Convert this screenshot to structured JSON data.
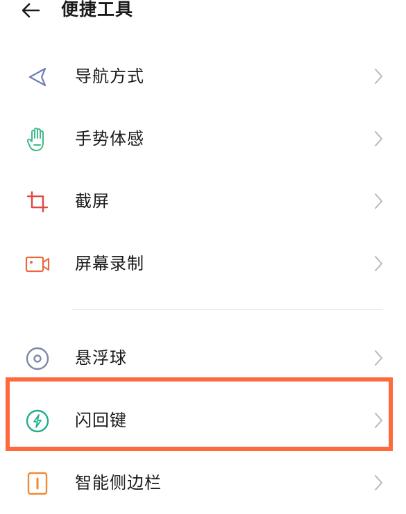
{
  "header": {
    "title": "便捷工具",
    "back_icon": "arrow-left-icon"
  },
  "items": [
    {
      "label": "导航方式",
      "icon": "navigation-arrow-icon",
      "icon_color": "#6c7fb3"
    },
    {
      "label": "手势体感",
      "icon": "hand-gesture-icon",
      "icon_color": "#3dbb86"
    },
    {
      "label": "截屏",
      "icon": "crop-icon",
      "icon_color": "#e0463e"
    },
    {
      "label": "屏幕录制",
      "icon": "video-camera-icon",
      "icon_color": "#e86a3a"
    },
    {
      "label": "悬浮球",
      "icon": "floating-ball-icon",
      "icon_color": "#7a8aa8"
    },
    {
      "label": "闪回键",
      "icon": "flash-icon",
      "icon_color": "#1fae8c"
    },
    {
      "label": "智能侧边栏",
      "icon": "sidebar-icon",
      "icon_color": "#f08a34"
    }
  ],
  "highlight_color": "#ff6a3d"
}
